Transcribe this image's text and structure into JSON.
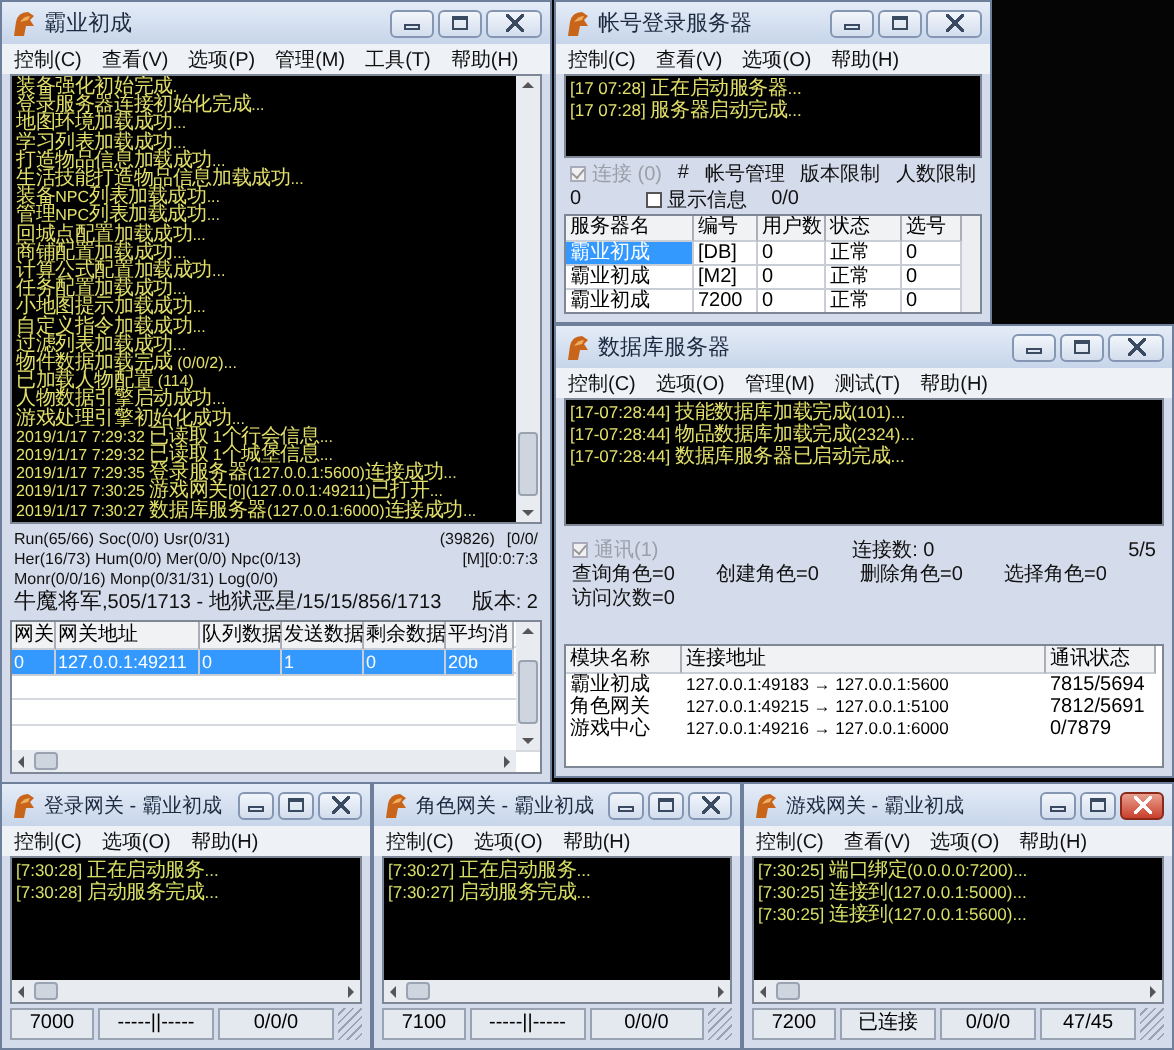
{
  "windows": [
    {
      "kind": "server",
      "title": "霸业初成",
      "active": false,
      "menu": [
        "控制(C)",
        "查看(V)",
        "选项(P)",
        "管理(M)",
        "工具(T)",
        "帮助(H)"
      ],
      "log": [
        "装备强化初始完成.",
        "登录服务器连接初始化完成...",
        "地图环境加载成功...",
        "学习列表加载成功...",
        "打造物品信息加载成功...",
        "生活技能打造物品信息加载成功...",
        "装备NPC列表加载成功...",
        "管理NPC列表加载成功...",
        "回城点配置加载成功...",
        "商铺配置加载成功...",
        "计算公式配置加载成功...",
        "任务配置加载成功...",
        "小地图提示加载成功...",
        "自定义指令加载成功...",
        "过滤列表加载成功...",
        "物件数据加载完成 (0/0/2)...",
        "已加载人物配置 (114)",
        "人物数据引擎启动成功...",
        "游戏处理引擎初始化成功...",
        "2019/1/17 7:29:32 已读取 1个行会信息...",
        "2019/1/17 7:29:32 已读取 1个城堡信息...",
        "2019/1/17 7:29:35 登录服务器(127.0.0.1:5600)连接成功...",
        "2019/1/17 7:30:25 游戏网关[0](127.0.0.1:49211)已打开...",
        "2019/1/17 7:30:27 数据库服务器(127.0.0.1:6000)连接成功..."
      ],
      "stats": [
        [
          "Run(65/66) Soc(0/0) Usr(0/31)",
          "(39826)",
          "[0/0/"
        ],
        [
          "Her(16/73) Hum(0/0) Mer(0/0) Npc(0/13)",
          "[M][0:0:7:3"
        ],
        [
          "Monr(0/0/16) Monp(0/31/31) Log(0/0)"
        ],
        [
          "牛魔将军,505/1713 - 地狱恶星/15/15/856/1713",
          "版本: 2"
        ]
      ],
      "table": {
        "columns": [
          "网关",
          "网关地址",
          "队列数据",
          "发送数据",
          "剩余数据",
          "平均消"
        ],
        "rows": [
          {
            "cells": [
              "0",
              "127.0.0.1:49211",
              "0",
              "1",
              "0",
              "20b"
            ],
            "selected": true
          }
        ]
      }
    },
    {
      "kind": "login",
      "title": "帐号登录服务器",
      "active": false,
      "menu": [
        "控制(C)",
        "查看(V)",
        "选项(O)",
        "帮助(H)"
      ],
      "log": [
        "[17 07:28] 正在启动服务器...",
        "[17 07:28] 服务器启动完成..."
      ],
      "options": [
        [
          {
            "kind": "checkbox",
            "label": "连接 (0)",
            "checked": true,
            "disabled": true
          },
          {
            "kind": "text",
            "label": "#"
          },
          {
            "kind": "text",
            "label": "帐号管理"
          },
          {
            "kind": "text",
            "label": "版本限制"
          },
          {
            "kind": "text",
            "label": "人数限制"
          }
        ],
        [
          {
            "kind": "text",
            "label": "0"
          },
          {
            "kind": "checkbox",
            "label": "显示信息",
            "checked": false,
            "disabled": false
          },
          {
            "kind": "text",
            "label": "0/0"
          }
        ]
      ],
      "table": {
        "columns": [
          "服务器名",
          "编号",
          "用户数",
          "状态",
          "选号"
        ],
        "rows": [
          {
            "cells": [
              "霸业初成",
              "[DB]",
              "0",
              "正常",
              "0"
            ],
            "selected": true
          },
          {
            "cells": [
              "霸业初成",
              "[M2]",
              "0",
              "正常",
              "0"
            ],
            "selected": false
          },
          {
            "cells": [
              "霸业初成",
              "7200",
              "0",
              "正常",
              "0"
            ],
            "selected": false
          }
        ]
      }
    },
    {
      "kind": "database",
      "title": "数据库服务器",
      "active": false,
      "menu": [
        "控制(C)",
        "选项(O)",
        "管理(M)",
        "测试(T)",
        "帮助(H)"
      ],
      "log": [
        "[17-07:28:44] 技能数据库加载完成(101)...",
        "[17-07:28:44] 物品数据库加载完成(2324)...",
        "[17-07:28:44] 数据库服务器已启动完成..."
      ],
      "options": [
        [
          {
            "kind": "checkbox",
            "label": "通讯(1)",
            "checked": true,
            "disabled": true
          },
          {
            "kind": "text",
            "label": "连接数: 0"
          },
          {
            "kind": "text",
            "label": "5/5"
          }
        ],
        [
          {
            "kind": "text",
            "label": "查询角色=0"
          },
          {
            "kind": "text",
            "label": "创建角色=0"
          },
          {
            "kind": "text",
            "label": "删除角色=0"
          },
          {
            "kind": "text",
            "label": "选择角色=0"
          }
        ],
        [
          {
            "kind": "text",
            "label": "访问次数=0"
          }
        ]
      ],
      "table": {
        "columns": [
          "模块名称",
          "连接地址",
          "通讯状态"
        ],
        "rows": [
          {
            "cells": [
              "霸业初成",
              "127.0.0.1:49183 → 127.0.0.1:5600",
              "7815/5694"
            ],
            "selected": false
          },
          {
            "cells": [
              "角色网关",
              "127.0.0.1:49215 → 127.0.0.1:5100",
              "7812/5691"
            ],
            "selected": false
          },
          {
            "cells": [
              "游戏中心",
              "127.0.0.1:49216 → 127.0.0.1:6000",
              "0/7879"
            ],
            "selected": false
          }
        ]
      }
    },
    {
      "kind": "gateway",
      "title": "登录网关 - 霸业初成",
      "active": false,
      "menu": [
        "控制(C)",
        "选项(O)",
        "帮助(H)"
      ],
      "log": [
        "[7:30:28] 正在启动服务...",
        "[7:30:28] 启动服务完成..."
      ],
      "status_bar": [
        "7000",
        "-----||-----",
        "0/0/0"
      ]
    },
    {
      "kind": "gateway",
      "title": "角色网关 - 霸业初成",
      "active": false,
      "menu": [
        "控制(C)",
        "选项(O)",
        "帮助(H)"
      ],
      "log": [
        "[7:30:27] 正在启动服务...",
        "[7:30:27] 启动服务完成..."
      ],
      "status_bar": [
        "7100",
        "-----||-----",
        "0/0/0"
      ]
    },
    {
      "kind": "gateway",
      "title": "游戏网关 - 霸业初成",
      "active": true,
      "menu": [
        "控制(C)",
        "查看(V)",
        "选项(O)",
        "帮助(H)"
      ],
      "log": [
        "[7:30:25] 端口绑定(0.0.0.0:7200)...",
        "[7:30:25] 连接到(127.0.0.1:5000)...",
        "[7:30:25] 连接到(127.0.0.1:5600)..."
      ],
      "status_bar": [
        "7200",
        "已连接",
        "0/0/0",
        "47/45"
      ]
    }
  ]
}
